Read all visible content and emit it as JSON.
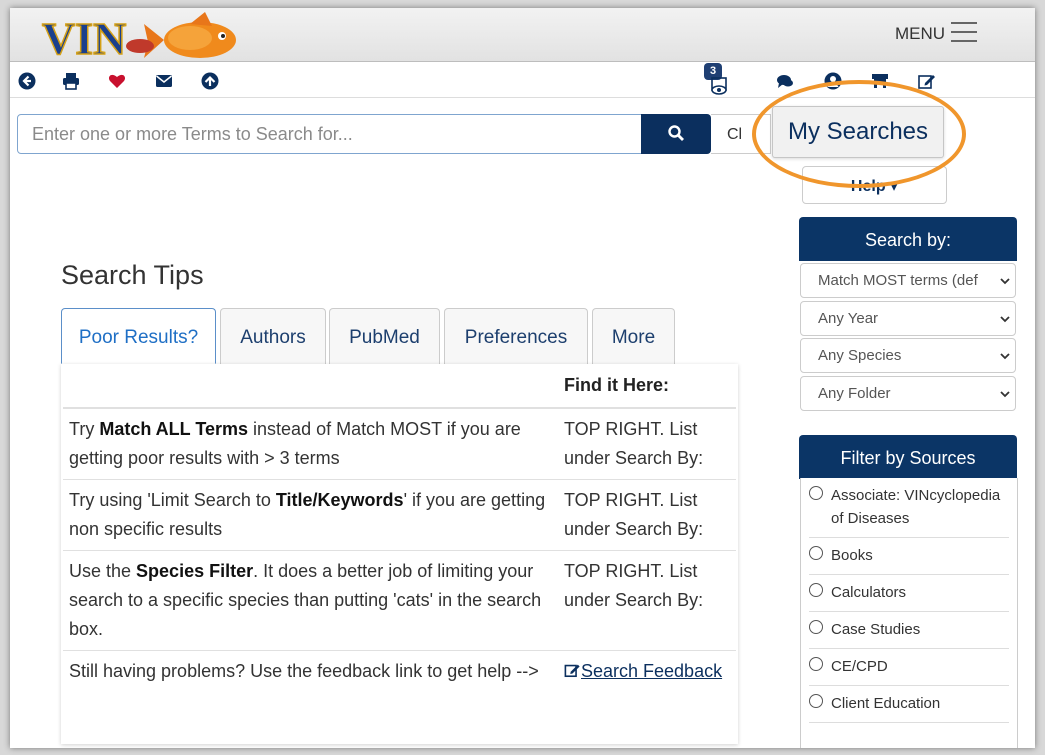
{
  "header": {
    "menu_label": "MENU"
  },
  "toolbar": {
    "watch_count": "3"
  },
  "search": {
    "placeholder": "Enter one or more Terms to Search for...",
    "clear_label": "Cl",
    "my_searches_label": "My Searches",
    "help_label": "Help ▾"
  },
  "tips": {
    "title": "Search Tips",
    "tabs": [
      "Poor Results?",
      "Authors",
      "PubMed",
      "Preferences",
      "More"
    ],
    "col2_header": "Find it Here:",
    "rows": [
      {
        "pre": "Try ",
        "bold": "Match ALL Terms",
        "post": " instead of Match MOST if you are getting poor results with > 3 terms",
        "where": "TOP RIGHT. List under Search By:"
      },
      {
        "pre": "Try using 'Limit Search to ",
        "bold": "Title/Keywords",
        "post": "' if you are getting non specific results",
        "where": "TOP RIGHT. List under Search By:"
      },
      {
        "pre": "Use the ",
        "bold": "Species Filter",
        "post": ". It does a better job of limiting your search to a specific species than putting 'cats' in the search box.",
        "where": "TOP RIGHT. List under Search By:"
      },
      {
        "pre": "Still having problems? Use the feedback link to get help -->",
        "bold": "",
        "post": "",
        "where": ""
      }
    ],
    "feedback_link": "Search Feedback"
  },
  "search_by": {
    "title": "Search by:",
    "options": [
      "Match MOST terms (def",
      "Any Year",
      "Any Species",
      "Any Folder"
    ]
  },
  "filter_sources": {
    "title": "Filter by Sources",
    "items": [
      "Associate: VINcyclopedia of Diseases",
      "Books",
      "Calculators",
      "Case Studies",
      "CE/CPD",
      "Client Education"
    ]
  },
  "colors": {
    "navy": "#0b3566",
    "highlight": "#f0962c",
    "tab_active": "#1f6fc5"
  }
}
